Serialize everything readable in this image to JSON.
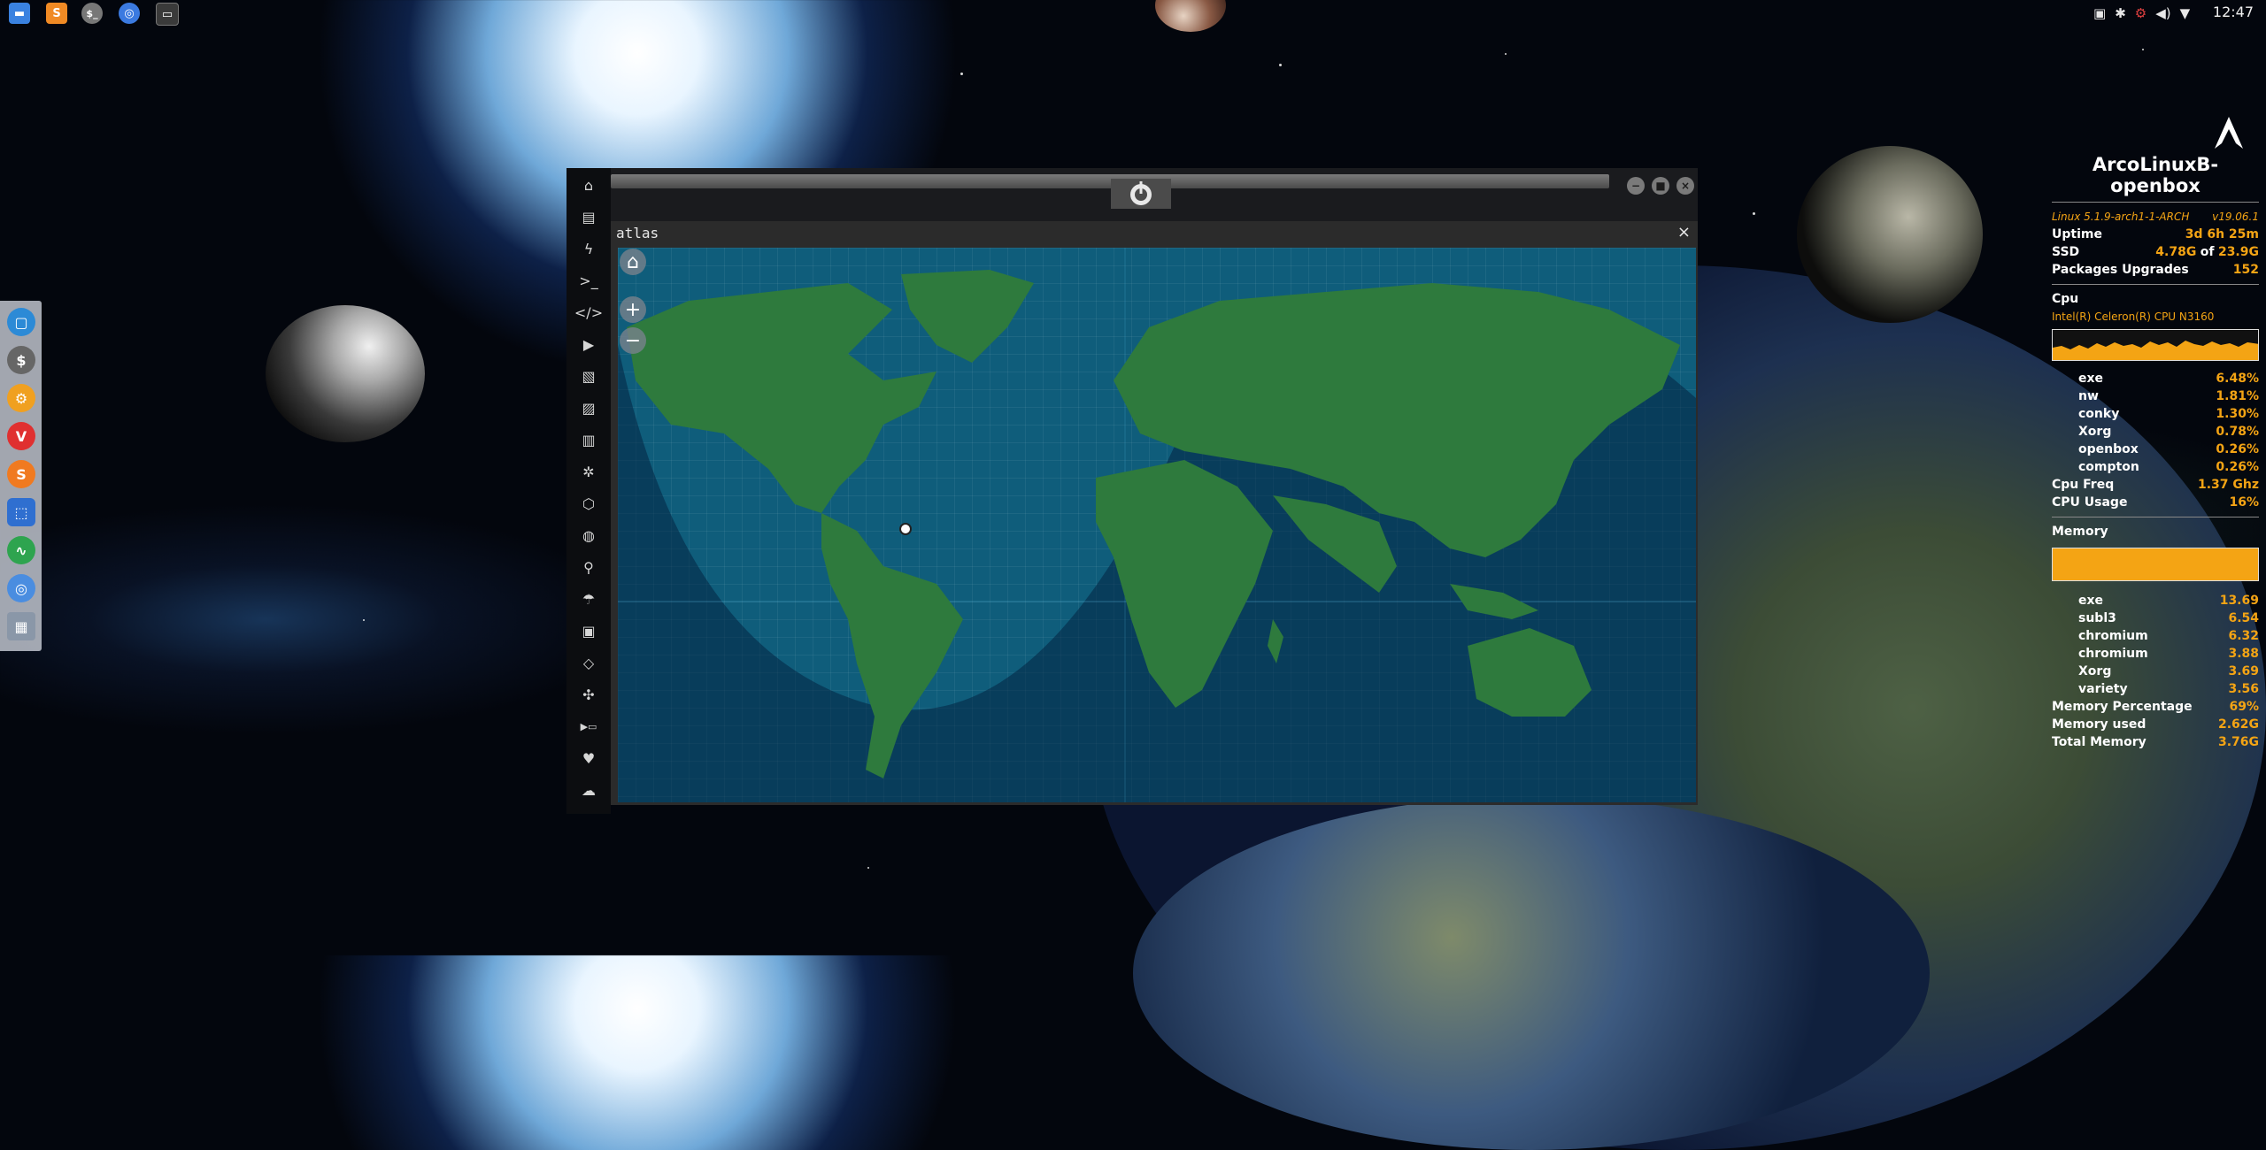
{
  "taskbar": {
    "apps": [
      {
        "icon": "folder-icon",
        "color": "#3a82e0"
      },
      {
        "icon": "sublime-text-icon",
        "color": "#f08a24"
      },
      {
        "icon": "shell-icon",
        "label": "$_",
        "color": "#777777"
      },
      {
        "icon": "chromium-icon",
        "color": "#3b7ae0"
      },
      {
        "icon": "terminal-icon",
        "color": "#3a3a3a"
      }
    ],
    "tray": [
      "screenshot-icon",
      "bluetooth-icon",
      "network-icon",
      "volume-icon",
      "wifi-icon"
    ],
    "clock": "12:47"
  },
  "dock": {
    "items": [
      {
        "icon": "files-icon",
        "glyph": "▢",
        "color": "#2c8ad6"
      },
      {
        "icon": "terminal-dollar-icon",
        "glyph": "$",
        "color": "#666666"
      },
      {
        "icon": "settings-icon",
        "glyph": "⚙",
        "color": "#f0a020"
      },
      {
        "icon": "vivaldi-icon",
        "glyph": "V",
        "color": "#e03030"
      },
      {
        "icon": "sublime-icon",
        "glyph": "S",
        "color": "#f07a20"
      },
      {
        "icon": "screen-capture-icon",
        "glyph": "⬚",
        "color": "#2f6fd0"
      },
      {
        "icon": "system-monitor-icon",
        "glyph": "∿",
        "color": "#2ea44f"
      },
      {
        "icon": "chromium-icon",
        "glyph": "◎",
        "color": "#4a8de0"
      },
      {
        "icon": "grid-icon",
        "glyph": "▦",
        "color": "#8a97a8"
      }
    ]
  },
  "app": {
    "sidebar_icons": [
      "home-icon",
      "document-icon",
      "lightning-icon",
      "terminal-icon",
      "code-icon",
      "play-icon",
      "gallery-icon",
      "image-icon",
      "news-icon",
      "settings-icon",
      "hexagon-icon",
      "globe-icon",
      "search-icon",
      "umbrella-icon",
      "user-card-icon",
      "tag-icon",
      "expand-icon",
      "youtube-icon",
      "heart-icon",
      "cloud-icon"
    ],
    "tab_icon": "rebel-alliance-icon",
    "window_title": "atlas",
    "close_glyph": "×",
    "map_controls": {
      "home": "⌂",
      "zoom_in": "+",
      "zoom_out": "−"
    },
    "colors": {
      "ocean": "#0f5d7b",
      "land": "#2e7a3d",
      "night": "rgba(2,30,60,0.55)"
    }
  },
  "conky": {
    "hostname": "ArcoLinuxB-openbox",
    "kernel": "Linux 5.1.9-arch1-1-ARCH",
    "version": "v19.06.1",
    "uptime": {
      "label": "Uptime",
      "value": "3d 6h 25m"
    },
    "ssd": {
      "label": "SSD",
      "used": "4.78G",
      "of": "of",
      "total": "23.9G"
    },
    "packages": {
      "label": "Packages Upgrades",
      "value": "152"
    },
    "cpu": {
      "label": "Cpu",
      "model": "Intel(R) Celeron(R) CPU  N3160",
      "processes": [
        {
          "name": "exe",
          "value": "6.48%"
        },
        {
          "name": "nw",
          "value": "1.81%"
        },
        {
          "name": "conky",
          "value": "1.30%"
        },
        {
          "name": "Xorg",
          "value": "0.78%"
        },
        {
          "name": "openbox",
          "value": "0.26%"
        },
        {
          "name": "compton",
          "value": "0.26%"
        }
      ],
      "freq": {
        "label": "Cpu Freq",
        "value": "1.37 Ghz"
      },
      "usage": {
        "label": "CPU Usage",
        "value": "16%"
      }
    },
    "memory": {
      "label": "Memory",
      "processes": [
        {
          "name": "exe",
          "value": "13.69"
        },
        {
          "name": "subl3",
          "value": "6.54"
        },
        {
          "name": "chromium",
          "value": "6.32"
        },
        {
          "name": "chromium",
          "value": "3.88"
        },
        {
          "name": "Xorg",
          "value": "3.69"
        },
        {
          "name": "variety",
          "value": "3.56"
        }
      ],
      "percentage": {
        "label": "Memory Percentage",
        "value": "69%"
      },
      "used": {
        "label": "Memory used",
        "value": "2.62G"
      },
      "total": {
        "label": "Total Memory",
        "value": "3.76G"
      }
    },
    "accent": "#f4a414",
    "distro_logo": "arch-logo-icon"
  }
}
